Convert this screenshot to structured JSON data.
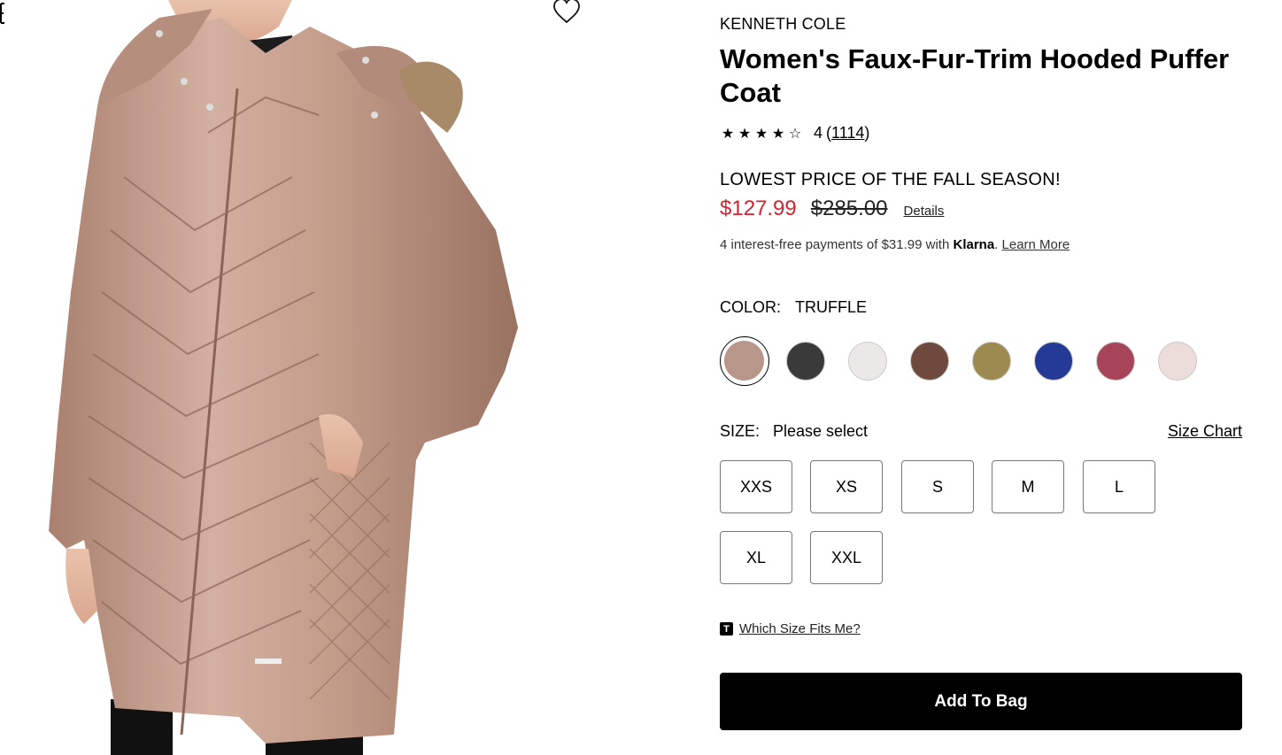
{
  "product": {
    "brand": "KENNETH COLE",
    "title": "Women's Faux-Fur-Trim Hooded Puffer Coat",
    "rating_value": "4",
    "rating_stars": 4,
    "review_count": "1114",
    "promo": "LOWEST PRICE OF THE FALL SEASON!",
    "sale_price": "$127.99",
    "original_price": "$285.00",
    "details_label": "Details"
  },
  "klarna": {
    "prefix": "4 interest-free payments of $31.99 with",
    "brand": "Klarna",
    "learn_more": "Learn More"
  },
  "color": {
    "label": "COLOR:",
    "selected": "TRUFFLE",
    "swatches": [
      {
        "name": "truffle",
        "hex": "#b8968a"
      },
      {
        "name": "black",
        "hex": "#3a3a3a"
      },
      {
        "name": "white",
        "hex": "#ece8e8"
      },
      {
        "name": "brown",
        "hex": "#6e4a3e"
      },
      {
        "name": "olive",
        "hex": "#9c8a50"
      },
      {
        "name": "blue",
        "hex": "#243a94"
      },
      {
        "name": "berry",
        "hex": "#a8445a"
      },
      {
        "name": "blush",
        "hex": "#ecdcda"
      }
    ]
  },
  "size": {
    "label": "SIZE:",
    "value": "Please select",
    "chart_label": "Size Chart",
    "options": [
      "XXS",
      "XS",
      "S",
      "M",
      "L",
      "XL",
      "XXL"
    ]
  },
  "fit": {
    "icon": "T",
    "label": "Which Size Fits Me?"
  },
  "cta": {
    "add_to_bag": "Add To Bag"
  },
  "icons": {
    "wishlist": "heart-icon"
  },
  "colors": {
    "sale": "#d12231",
    "button_bg": "#000000"
  }
}
